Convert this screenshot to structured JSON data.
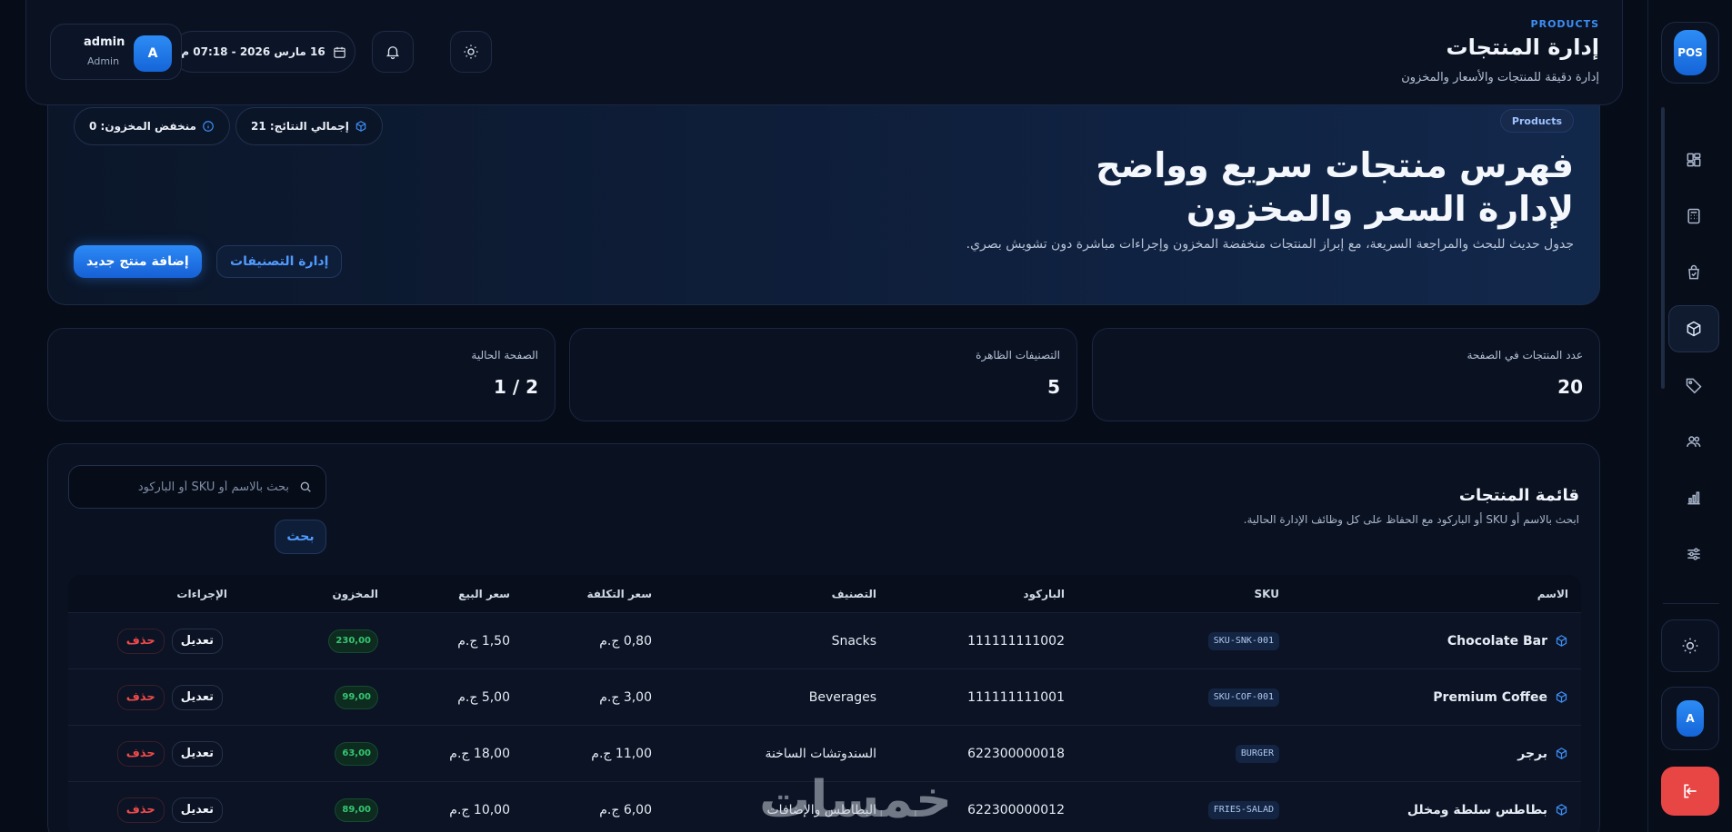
{
  "app": {
    "logo": "POS",
    "theme_icon": "sun-icon"
  },
  "header": {
    "kicker": "PRODUCTS",
    "title": "إدارة المنتجات",
    "subtitle": "إدارة دقيقة للمنتجات والأسعار والمخزون",
    "datetime": "16 مارس 2026 - 07:18 م",
    "user": {
      "initial": "A",
      "name": "admin",
      "role": "Admin"
    }
  },
  "hero": {
    "tag": "Products",
    "title": "فهرس منتجات سريع وواضح لإدارة السعر والمخزون",
    "description": "جدول حديث للبحث والمراجعة السريعة، مع إبراز المنتجات منخفضة المخزون وإجراءات مباشرة دون تشويش بصري.",
    "total_results": "إجمالي النتائج: 21",
    "low_stock": "منخفض المخزون: 0",
    "add_button": "إضافة منتج جديد",
    "categories_button": "إدارة التصنيفات"
  },
  "metrics": [
    {
      "label": "عدد المنتجات في الصفحة",
      "value": "20"
    },
    {
      "label": "التصنيفات الظاهرة",
      "value": "5"
    },
    {
      "label": "الصفحة الحالية",
      "value": "1 / 2"
    }
  ],
  "products": {
    "title": "قائمة المنتجات",
    "subtitle": "ابحث بالاسم أو SKU أو الباركود مع الحفاظ على كل وظائف الإدارة الحالية.",
    "search_placeholder": "بحث بالاسم أو SKU أو الباركود",
    "search_value": "",
    "search_button": "بحث",
    "columns": {
      "name": "الاسم",
      "sku": "SKU",
      "barcode": "الباركود",
      "category": "التصنيف",
      "cost": "سعر التكلفة",
      "price": "سعر البيع",
      "stock": "المخزون",
      "actions": "الإجراءات"
    },
    "edit_label": "تعديل",
    "delete_label": "حذف",
    "rows": [
      {
        "name": "Chocolate Bar",
        "sku": "SKU-SNK-001",
        "barcode": "111111111002",
        "category": "Snacks",
        "cost": "0,80 ج.م",
        "price": "1,50 ج.م",
        "stock": "230,00"
      },
      {
        "name": "Premium Coffee",
        "sku": "SKU-COF-001",
        "barcode": "111111111001",
        "category": "Beverages",
        "cost": "3,00 ج.م",
        "price": "5,00 ج.م",
        "stock": "99,00"
      },
      {
        "name": "برجر",
        "sku": "BURGER",
        "barcode": "622300000018",
        "category": "السندوتشات الساخنة",
        "cost": "11,00 ج.م",
        "price": "18,00 ج.م",
        "stock": "63,00"
      },
      {
        "name": "بطاطس سلطة ومخلل",
        "sku": "FRIES-SALAD",
        "barcode": "622300000012",
        "category": "البطاطس والإضافات",
        "cost": "6,00 ج.م",
        "price": "10,00 ج.م",
        "stock": "89,00"
      }
    ]
  },
  "watermark": "خمسات"
}
